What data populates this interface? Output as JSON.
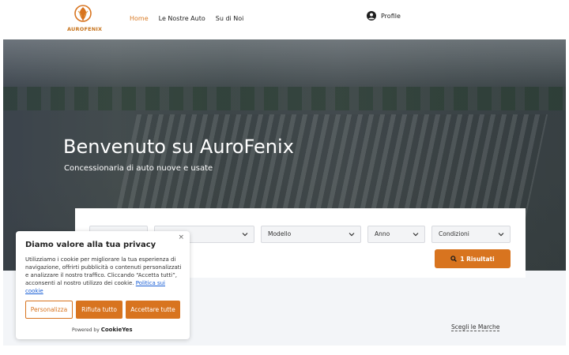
{
  "brand": {
    "name": "AUROFENIX",
    "accent": "#d8741f"
  },
  "nav": {
    "items": [
      "Home",
      "Le Nostre Auto",
      "Su di Noi"
    ],
    "active": "Home"
  },
  "profile": {
    "label": "Profile",
    "icon": "user-circle-icon"
  },
  "hero": {
    "title": "Benvenuto su AuroFenix",
    "subtitle": "Concessionaria di auto nuove e usate"
  },
  "search": {
    "filters": [
      {
        "name": "brand",
        "value": ""
      },
      {
        "name": "model-group",
        "value": ""
      },
      {
        "name": "model",
        "value": "Modello"
      },
      {
        "name": "year",
        "value": "Anno"
      },
      {
        "name": "condition",
        "value": "Condizioni"
      }
    ],
    "results_label": "1 Risultati"
  },
  "brands_link": "Scegli le Marche",
  "cookie": {
    "title": "Diamo valore alla tua privacy",
    "body": "Utilizziamo i cookie per migliorare la tua esperienza di navigazione, offrirti pubblicità o contenuti personalizzati e analizzare il nostro traffico. Cliccando “Accetta tutti”, acconsenti al nostro utilizzo dei cookie.",
    "policy_link": "Politica sui cookie",
    "buttons": {
      "customize": "Personalizza",
      "reject": "Rifiuta tutto",
      "accept": "Accettare tutte"
    },
    "powered_by": "Powered by",
    "powered_brand": "CookieYes",
    "close": "×"
  }
}
